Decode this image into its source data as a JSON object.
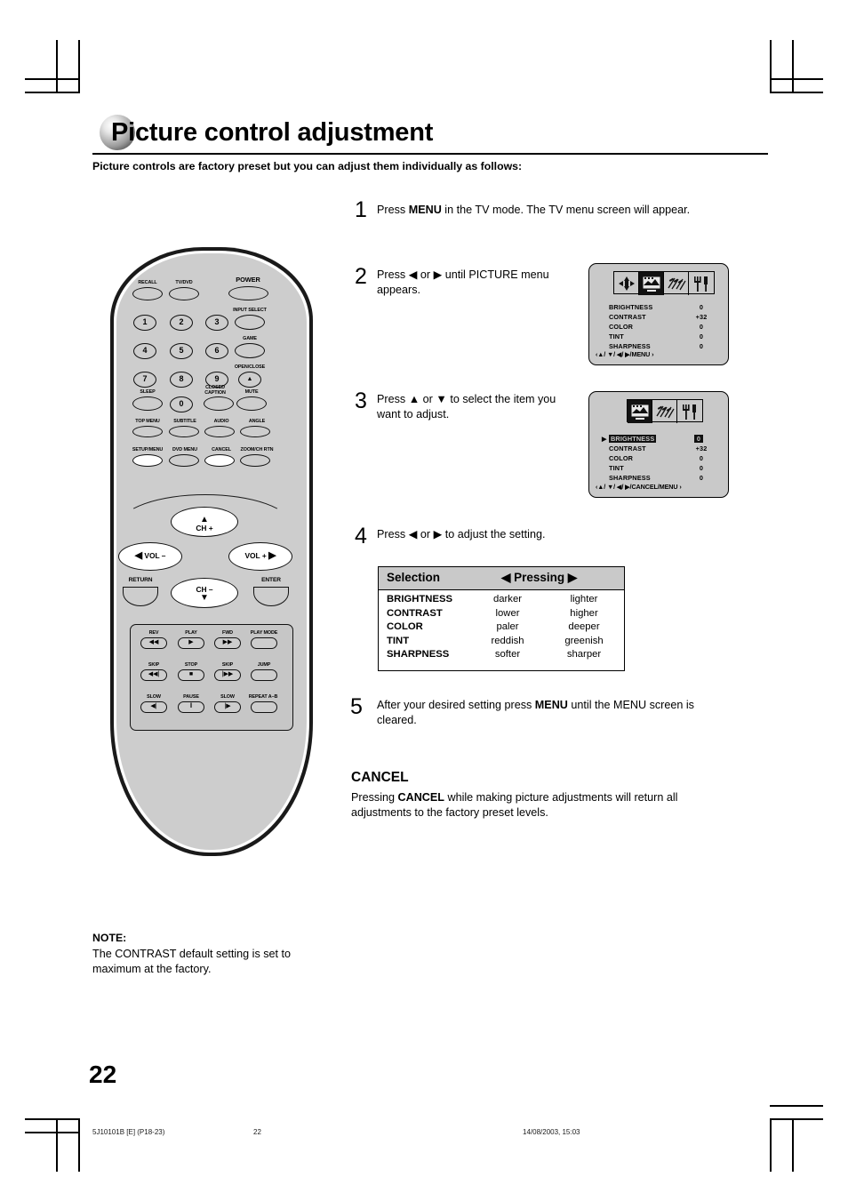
{
  "header": {
    "title": "Picture control adjustment",
    "subtitle": "Picture controls are factory preset but you can adjust them individually as follows:"
  },
  "steps": [
    {
      "num": "1",
      "text_html": "Press <b>MENU</b> in the TV mode. The TV menu screen will appear."
    },
    {
      "num": "2",
      "text_html": "Press ◀ or ▶ until PICTURE menu appears."
    },
    {
      "num": "3",
      "text_html": "Press ▲ or ▼ to select the item you want to adjust."
    },
    {
      "num": "4",
      "text_html": "Press ◀ or ▶ to adjust the setting."
    },
    {
      "num": "5",
      "text_html": "After your desired setting press <b>MENU</b> until the MENU screen is cleared."
    }
  ],
  "osd1": {
    "tabs": [
      "position-arrows-icon",
      "picture-tv-icon",
      "audio-notes-icon",
      "setup-tools-icon"
    ],
    "selected_tab": 1,
    "rows": [
      {
        "name": "BRIGHTNESS",
        "value": "0"
      },
      {
        "name": "CONTRAST",
        "value": "+32"
      },
      {
        "name": "COLOR",
        "value": "0"
      },
      {
        "name": "TINT",
        "value": "0"
      },
      {
        "name": "SHARPNESS",
        "value": "0"
      }
    ],
    "hint": "‹▲/ ▼/ ◀/ ▶/MENU ›"
  },
  "osd2": {
    "tabs": [
      "picture-tv-icon",
      "audio-notes-icon",
      "setup-tools-icon"
    ],
    "selected_tab": 0,
    "rows": [
      {
        "name": "BRIGHTNESS",
        "value": "0",
        "highlighted": true
      },
      {
        "name": "CONTRAST",
        "value": "+32"
      },
      {
        "name": "COLOR",
        "value": "0"
      },
      {
        "name": "TINT",
        "value": "0"
      },
      {
        "name": "SHARPNESS",
        "value": "0"
      }
    ],
    "hint": "‹▲/ ▼/ ◀/ ▶/CANCEL/MENU ›"
  },
  "selection_table": {
    "headers": {
      "selection": "Selection",
      "pressing": "◀  Pressing  ▶"
    },
    "rows": [
      {
        "item": "BRIGHTNESS",
        "left": "darker",
        "right": "lighter"
      },
      {
        "item": "CONTRAST",
        "left": "lower",
        "right": "higher"
      },
      {
        "item": "COLOR",
        "left": "paler",
        "right": "deeper"
      },
      {
        "item": "TINT",
        "left": "reddish",
        "right": "greenish"
      },
      {
        "item": "SHARPNESS",
        "left": "softer",
        "right": "sharper"
      }
    ]
  },
  "cancel_section": {
    "heading": "CANCEL",
    "body_html": "Pressing <b>CANCEL</b> while making picture adjustments will return all adjustments to the factory preset levels."
  },
  "note": {
    "heading": "NOTE:",
    "body": "The CONTRAST default setting is set to maximum at the factory."
  },
  "page_number": "22",
  "footer": {
    "code": "5J10101B [E] (P18-23)",
    "page": "22",
    "date": "14/08/2003, 15:03"
  },
  "remote": {
    "row_labels_top": [
      "RECALL",
      "TV/DVD",
      "POWER"
    ],
    "side_labels": [
      "INPUT SELECT",
      "GAME",
      "OPEN/CLOSE"
    ],
    "keypad": [
      "1",
      "2",
      "3",
      "4",
      "5",
      "6",
      "7",
      "8",
      "9",
      "0"
    ],
    "function_labels": [
      "SLEEP",
      "CLOSED CAPTION",
      "MUTE",
      "TOP MENU",
      "SUBTITLE",
      "AUDIO",
      "ANGLE",
      "SETUP/MENU",
      "DVD MENU",
      "CANCEL",
      "ZOOM/CH RTN"
    ],
    "nav": {
      "ch_up": "CH +",
      "ch_down": "CH –",
      "vol_down": "VOL –",
      "vol_up": "VOL +",
      "return": "RETURN",
      "enter": "ENTER"
    },
    "transport": {
      "labels": [
        "REV",
        "PLAY",
        "FWD",
        "PLAY MODE",
        "SKIP",
        "STOP",
        "SKIP",
        "JUMP",
        "SLOW",
        "PAUSE",
        "SLOW",
        "REPEAT A–B"
      ],
      "glyphs": [
        "◀◀",
        "▶",
        "▶▶",
        "",
        "◀◀|",
        "■",
        "|▶▶",
        "",
        "◀|",
        "‖",
        "|▶",
        ""
      ]
    },
    "eject_glyph": "▲",
    "highlighted_buttons": [
      "SETUP/MENU",
      "CANCEL"
    ]
  }
}
